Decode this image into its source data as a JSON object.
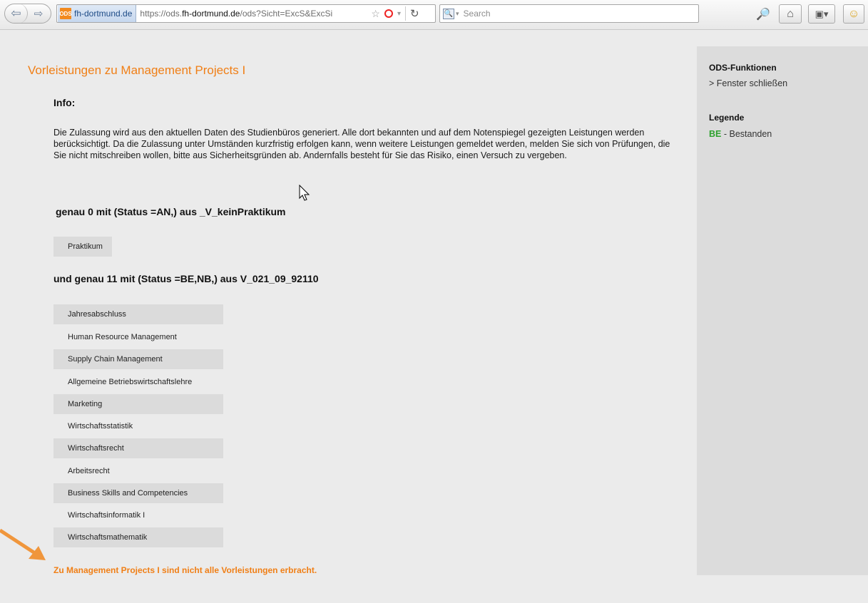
{
  "browser": {
    "identity_label": "fh-dortmund.de",
    "favicon_text": "ODS",
    "url_prefix": "https://ods.",
    "url_domain": "fh-dortmund.de",
    "url_rest": "/ods?Sicht=ExcS&ExcSi",
    "search_placeholder": "Search"
  },
  "main": {
    "title": "Vorleistungen zu Management Projects I",
    "info_heading": "Info:",
    "info_text": "Die Zulassung wird aus den aktuellen Daten des Studienbüros generiert. Alle dort bekannten und auf dem Notenspiegel gezeigten Leistungen werden berücksichtigt. Da die Zulassung unter Umständen kurzfristig erfolgen kann, wenn weitere Leistungen gemeldet werden, melden Sie sich von Prüfungen, die Sie nicht mitschreiben wollen, bitte aus Sicherheitsgründen ab. Andernfalls besteht für Sie das Risiko, einen Versuch zu vergeben.",
    "requirement1": "genau 0 mit (Status =AN,) aus _V_keinPraktikum",
    "requirement1_courses": [
      "Praktikum"
    ],
    "requirement2": "und genau 11 mit (Status =BE,NB,) aus V_021_09_92110",
    "requirement2_courses": [
      "Jahresabschluss",
      "Human Resource Management",
      "Supply Chain Management",
      "Allgemeine Betriebswirtschaftslehre",
      "Marketing",
      "Wirtschaftsstatistik",
      "Wirtschaftsrecht",
      "Arbeitsrecht",
      "Business Skills and Competencies",
      "Wirtschaftsinformatik I",
      "Wirtschaftsmathematik"
    ],
    "result": "Zu Management Projects I sind nicht alle Vorleistungen erbracht."
  },
  "sidebar": {
    "functions_heading": "ODS-Funktionen",
    "close_link": ">  Fenster schließen",
    "legend_heading": "Legende",
    "legend_code": "BE",
    "legend_label": " - Bestanden"
  },
  "colors": {
    "accent_orange": "#f07f16",
    "legend_green": "#2ea12e"
  }
}
